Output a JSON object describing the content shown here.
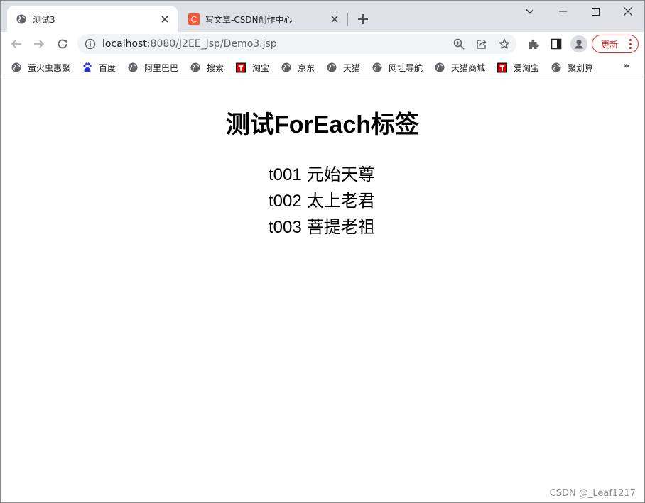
{
  "tabs": [
    {
      "title": "测试3",
      "active": true,
      "icon": "globe-icon"
    },
    {
      "title": "写文章-CSDN创作中心",
      "active": false,
      "icon": "csdn-c-icon",
      "icon_letter": "C",
      "icon_color": "#fc5531"
    }
  ],
  "window_controls": [
    "chevron-down-icon",
    "minimize-icon",
    "maximize-icon",
    "close-icon"
  ],
  "toolbar": {
    "url_host": "localhost",
    "url_path": ":8080/J2EE_Jsp/Demo3.jsp",
    "update_label": "更新"
  },
  "bookmarks": [
    {
      "label": "萤火虫惠聚",
      "icon": "globe-icon"
    },
    {
      "label": "百度",
      "icon": "baidu-paw-icon"
    },
    {
      "label": "阿里巴巴",
      "icon": "globe-icon"
    },
    {
      "label": "搜索",
      "icon": "globe-icon"
    },
    {
      "label": "淘宝",
      "icon": "t-logo-icon"
    },
    {
      "label": "京东",
      "icon": "globe-icon"
    },
    {
      "label": "天猫",
      "icon": "globe-icon"
    },
    {
      "label": "网址导航",
      "icon": "globe-icon"
    },
    {
      "label": "天猫商城",
      "icon": "globe-icon"
    },
    {
      "label": "爱淘宝",
      "icon": "t-logo-icon"
    },
    {
      "label": "聚划算",
      "icon": "globe-icon"
    }
  ],
  "bookmarks_more": "»",
  "page": {
    "heading": "测试ForEach标签",
    "items": [
      {
        "id": "t001",
        "name": "元始天尊"
      },
      {
        "id": "t002",
        "name": "太上老君"
      },
      {
        "id": "t003",
        "name": "菩提老祖"
      }
    ]
  },
  "watermark": "CSDN @_Leaf1217",
  "colors": {
    "tabstrip_bg": "#dee1e6",
    "update_accent": "#d93025",
    "t_logo_bg": "#e00000"
  }
}
